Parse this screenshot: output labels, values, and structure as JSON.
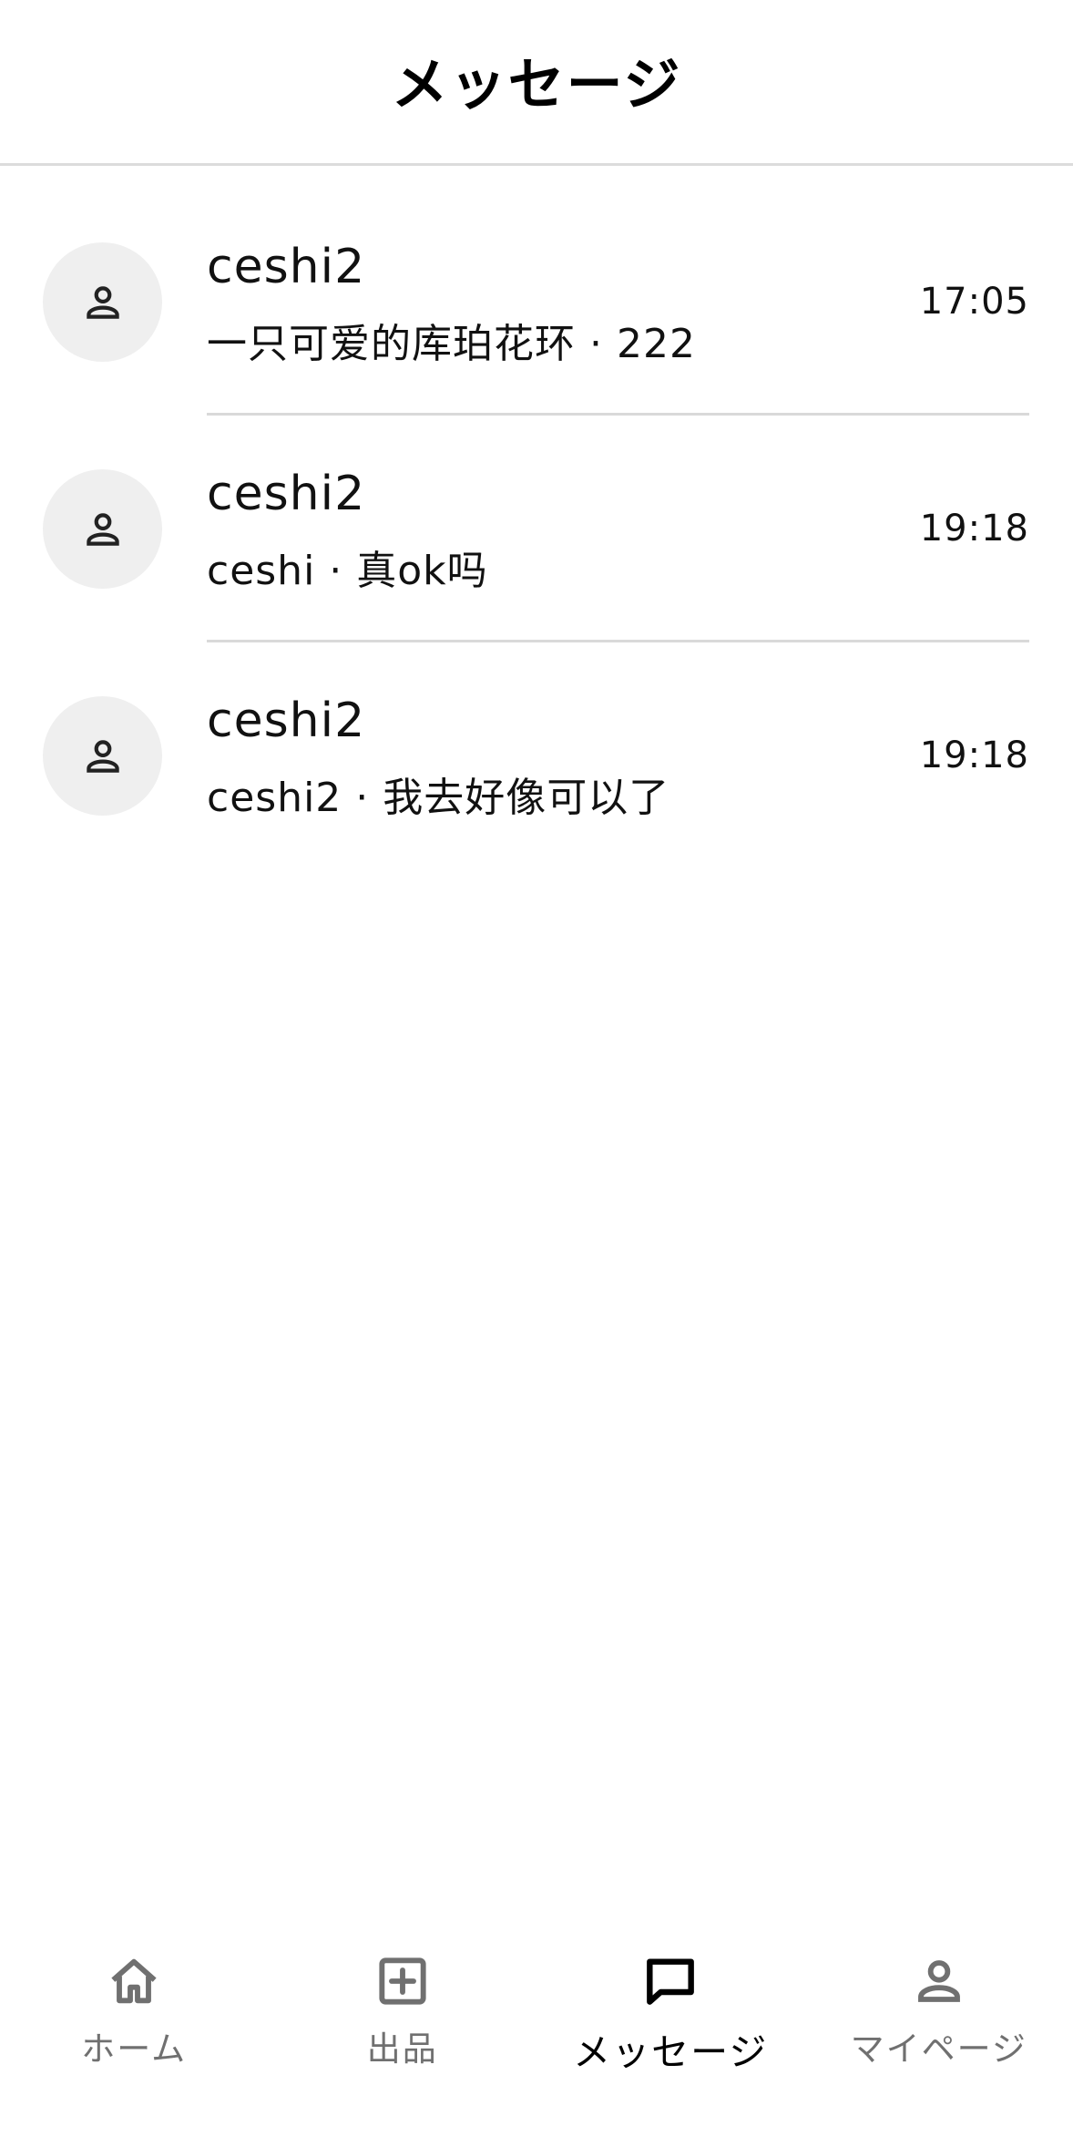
{
  "header": {
    "title": "メッセージ"
  },
  "conversations": [
    {
      "name": "ceshi2",
      "preview": "一只可爱的库珀花环 · 222",
      "time": "17:05",
      "avatar_icon": "person-icon"
    },
    {
      "name": "ceshi2",
      "preview": "ceshi · 真ok吗",
      "time": "19:18",
      "avatar_icon": "person-icon"
    },
    {
      "name": "ceshi2",
      "preview": "ceshi2 · 我去好像可以了",
      "time": "19:18",
      "avatar_icon": "person-icon"
    }
  ],
  "tabbar": {
    "active": "messages",
    "tabs": [
      {
        "id": "home",
        "label": "ホーム",
        "icon": "home-icon"
      },
      {
        "id": "listing",
        "label": "出品",
        "icon": "plus-square-icon"
      },
      {
        "id": "messages",
        "label": "メッセージ",
        "icon": "chat-bubble-icon"
      },
      {
        "id": "mypage",
        "label": "マイページ",
        "icon": "person-icon"
      }
    ]
  },
  "colors": {
    "background": "#ffffff",
    "divider": "#d9d9d9",
    "avatar_bg": "#efefef",
    "inactive_tab": "#707070",
    "active_tab": "#000000"
  }
}
